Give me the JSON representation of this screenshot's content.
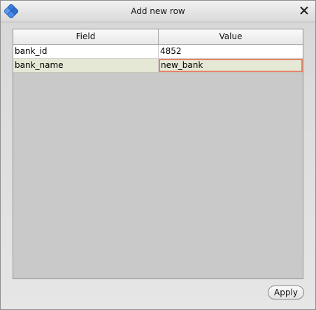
{
  "window": {
    "title": "Add new row",
    "app_icon": "puzzle-cube-icon",
    "close_icon": "close-icon"
  },
  "table": {
    "columns": [
      "Field",
      "Value"
    ],
    "rows": [
      {
        "field": "bank_id",
        "value": "4852"
      },
      {
        "field": "bank_name",
        "value": "new_bank"
      }
    ],
    "selected_row_index": 1,
    "editing_cell": "value"
  },
  "footer": {
    "apply_label": "Apply"
  },
  "colors": {
    "selected_row": "#e6e8d6",
    "edit_border": "#e5836b",
    "icon_blue": "#2f6fd0"
  }
}
